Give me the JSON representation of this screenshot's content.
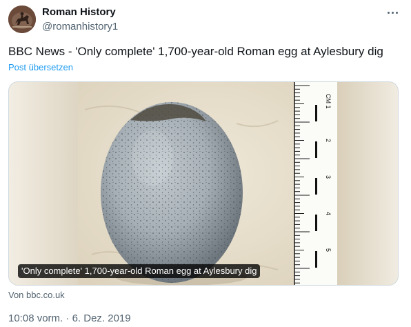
{
  "author": {
    "name": "Roman History",
    "handle": "@romanhistory1",
    "avatar_icon": "avatar-horseman-icon"
  },
  "more_icon": "more-horizontal-icon",
  "tweet": {
    "text": "BBC News - 'Only complete' 1,700-year-old Roman egg at Aylesbury dig",
    "translate_label": "Post übersetzen"
  },
  "card": {
    "title": "'Only complete' 1,700-year-old Roman egg at Aylesbury dig",
    "source": "Von bbc.co.uk",
    "ruler": {
      "unit": "CM",
      "numbers": [
        "1",
        "2",
        "3",
        "4",
        "5"
      ]
    }
  },
  "timestamp": {
    "time": "10:08 vorm.",
    "separator": " · ",
    "date": "6. Dez. 2019"
  },
  "colors": {
    "text_primary": "#0f1419",
    "text_secondary": "#536471",
    "link": "#1d9bf0",
    "border": "#cfd9de"
  }
}
